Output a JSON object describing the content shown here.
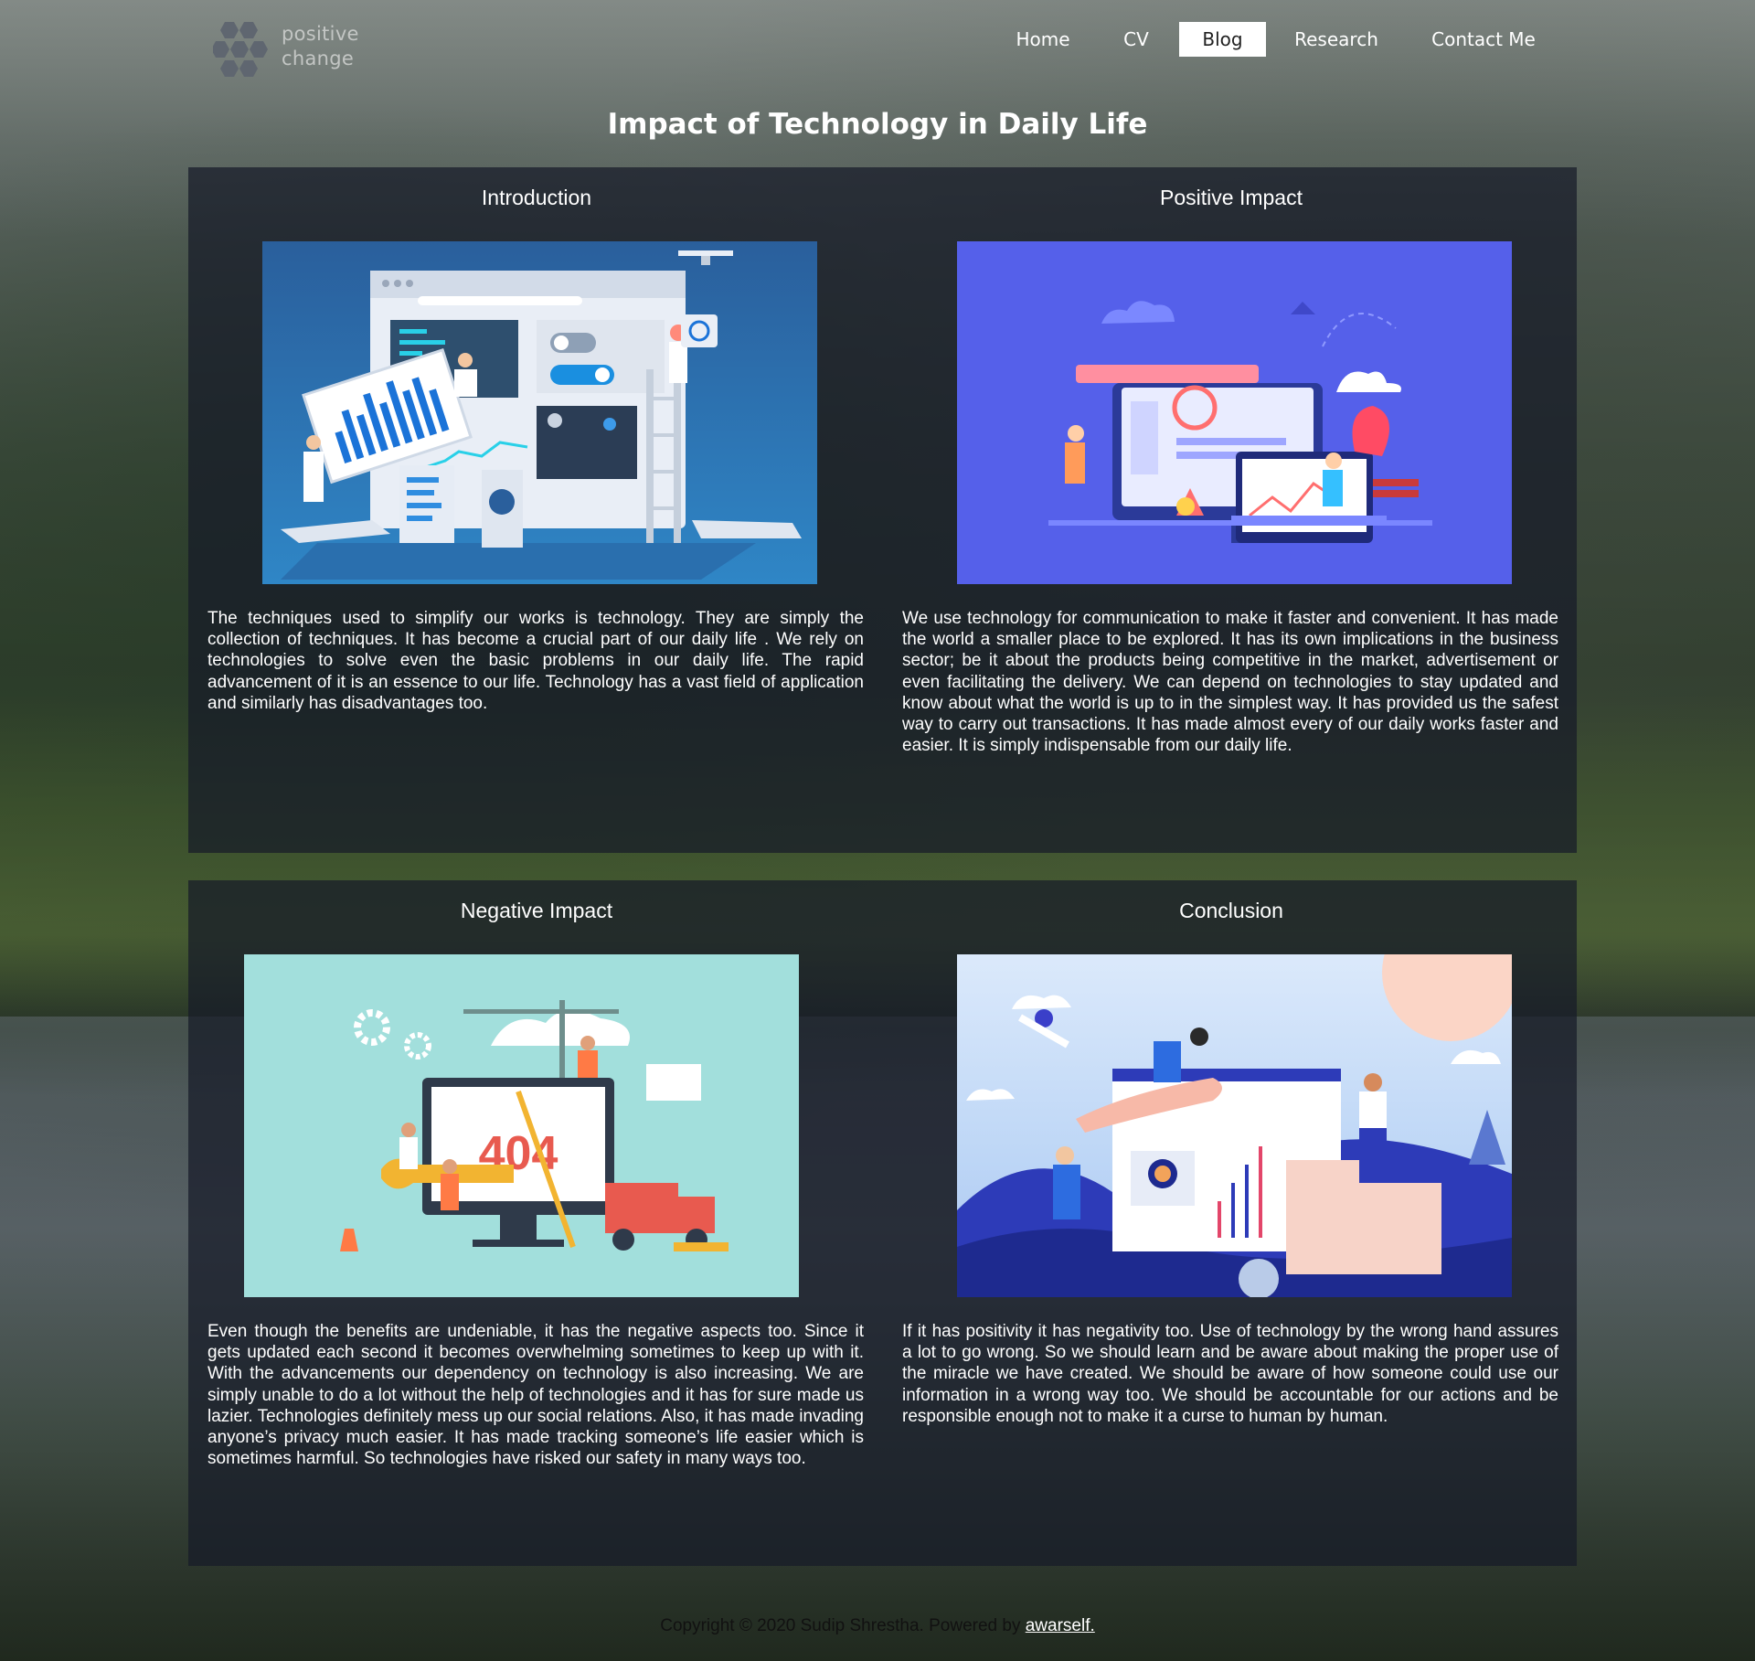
{
  "brand": {
    "line1": "positive",
    "line2": "change"
  },
  "nav": [
    {
      "label": "Home",
      "active": false
    },
    {
      "label": "CV",
      "active": false
    },
    {
      "label": "Blog",
      "active": true
    },
    {
      "label": "Research",
      "active": false
    },
    {
      "label": "Contact Me",
      "active": false
    }
  ],
  "page_title": "Impact of Technology in Daily Life",
  "sections": [
    {
      "title": "Introduction",
      "image": "technology-dashboard-illustration",
      "text": "The techniques used to simplify our works is technology. They are simply the collection of techniques. It has become a crucial part of our daily life . We rely on technologies to solve even the basic problems in our daily life. The rapid advancement of it is an essence to our life. Technology has a vast field of application and similarly has disadvantages too."
    },
    {
      "title": "Positive Impact",
      "image": "connected-devices-illustration",
      "text": "We use technology for communication to make it faster and convenient. It has made the world a smaller place to be explored. It has its own implications in the business sector; be it about the products being competitive in the market, advertisement or even facilitating the delivery. We can depend on technologies to stay updated and know about what the world is up to in the simplest way. It has provided us the safest way to carry out transactions. It has made almost every of our daily works faster and easier. It is simply indispensable from our daily life."
    },
    {
      "title": "Negative Impact",
      "image": "404-error-illustration",
      "text": "Even though the benefits are undeniable, it has the negative aspects too. Since it gets updated each second it becomes overwhelming sometimes to keep up with it. With the advancements our dependency on technology is also increasing. We are simply unable to do a lot without the help of technologies and it has for sure made us lazier. Technologies definitely mess up our social relations. Also, it has made invading anyone’s privacy much easier. It has made tracking someone’s life easier which is sometimes harmful. So technologies have risked our safety in many ways too."
    },
    {
      "title": "Conclusion",
      "image": "teamwork-growth-illustration",
      "text": "If it has positivity it has negativity too. Use of technology by the wrong hand assures a lot to go wrong. So we should learn and be aware about making the proper use of the miracle we have created. We should be aware of how someone could use our information in a wrong way too. We should be accountable for our actions and be responsible enough not to make it a curse to human by human."
    }
  ],
  "footer": {
    "text": "Copyright © 2020 Sudip Shrestha. Powered by ",
    "link": "awarself."
  },
  "colors": {
    "panel": "#161b28",
    "intro_bg": "#2f7fbf",
    "positive_bg": "#5560ea",
    "negative_bg": "#a2dfdc",
    "conclusion_bg": "#c7dcf7"
  }
}
